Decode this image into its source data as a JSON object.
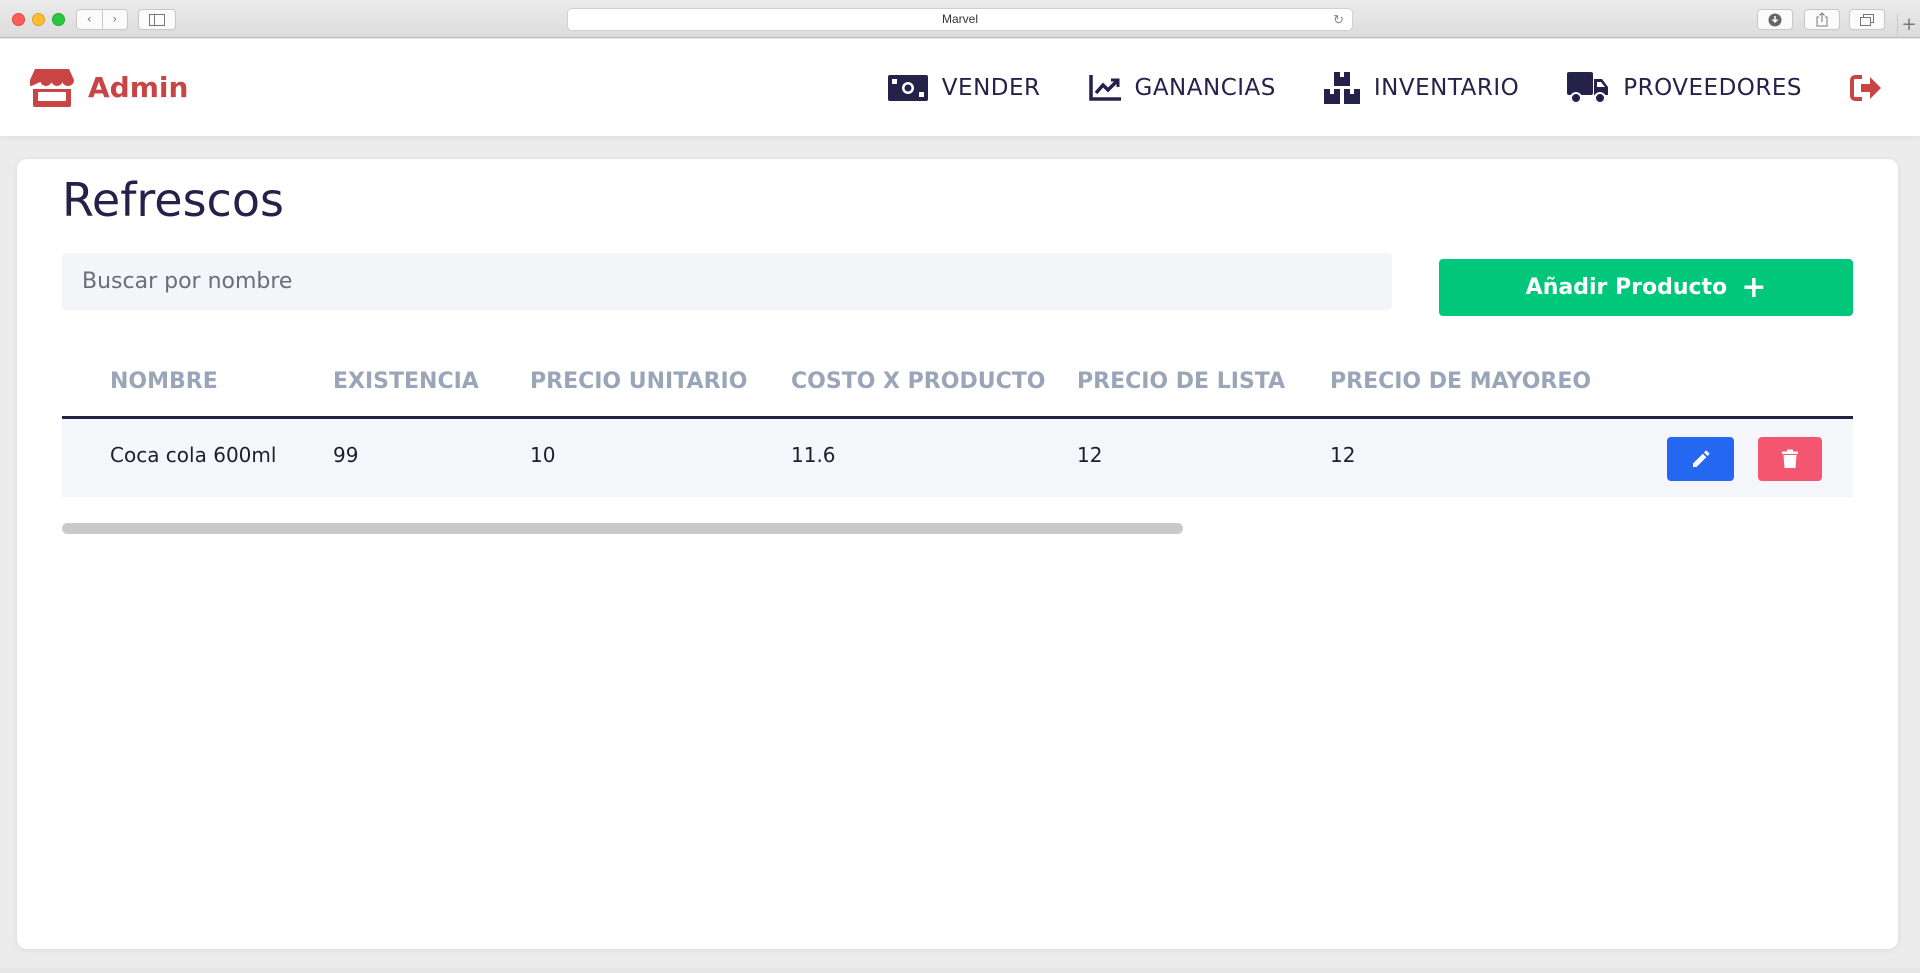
{
  "browser": {
    "url": "Marvel",
    "new_tab_glyph": "+"
  },
  "header": {
    "brand": "Admin",
    "nav": [
      {
        "label": "VENDER",
        "icon": "money-icon"
      },
      {
        "label": "GANANCIAS",
        "icon": "chart-line-icon"
      },
      {
        "label": "INVENTARIO",
        "icon": "boxes-icon"
      },
      {
        "label": "PROVEEDORES",
        "icon": "truck-icon"
      }
    ],
    "logout_icon": "sign-out-icon"
  },
  "main": {
    "title": "Refrescos",
    "search": {
      "placeholder": "Buscar por nombre",
      "value": ""
    },
    "add_button": {
      "label": "Añadir Producto",
      "icon": "+"
    },
    "table": {
      "columns": [
        "NOMBRE",
        "EXISTENCIA",
        "PRECIO UNITARIO",
        "COSTO X PRODUCTO",
        "PRECIO DE LISTA",
        "PRECIO DE MAYOREO"
      ],
      "rows": [
        [
          "Coca cola 600ml",
          "99",
          "10",
          "11.6",
          "12",
          "12"
        ]
      ]
    }
  },
  "colors": {
    "brand": "#c94545",
    "nav_text": "#25224a",
    "add": "#00c77a",
    "edit": "#2468f2",
    "delete": "#f5566f",
    "header_text": "#9aa6b8"
  }
}
